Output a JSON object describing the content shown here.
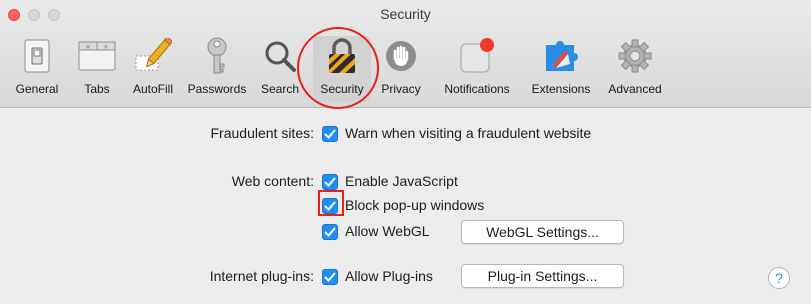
{
  "window": {
    "title": "Security"
  },
  "toolbar": {
    "items": [
      {
        "label": "General",
        "icon": "general-switch-icon"
      },
      {
        "label": "Tabs",
        "icon": "tabs-icon"
      },
      {
        "label": "AutoFill",
        "icon": "autofill-pencil-icon"
      },
      {
        "label": "Passwords",
        "icon": "key-icon"
      },
      {
        "label": "Search",
        "icon": "magnifier-icon"
      },
      {
        "label": "Security",
        "icon": "padlock-icon",
        "selected": true
      },
      {
        "label": "Privacy",
        "icon": "hand-icon"
      },
      {
        "label": "Notifications",
        "icon": "notification-badge-icon"
      },
      {
        "label": "Extensions",
        "icon": "puzzle-icon"
      },
      {
        "label": "Advanced",
        "icon": "gear-icon"
      }
    ]
  },
  "content": {
    "fraudulent": {
      "label": "Fraudulent sites:",
      "warn": {
        "text": "Warn when visiting a fraudulent website",
        "checked": true
      }
    },
    "web_content": {
      "label": "Web content:",
      "javascript": {
        "text": "Enable JavaScript",
        "checked": true
      },
      "popups": {
        "text": "Block pop-up windows",
        "checked": true
      },
      "webgl": {
        "text": "Allow WebGL",
        "checked": true
      },
      "webgl_settings_button": "WebGL Settings..."
    },
    "plugins": {
      "label": "Internet plug-ins:",
      "allow": {
        "text": "Allow Plug-ins",
        "checked": true
      },
      "plugin_settings_button": "Plug-in Settings..."
    },
    "help_label": "?"
  },
  "colors": {
    "checkbox_blue": "#1e8ef2",
    "annotation_red": "#e8201a"
  }
}
